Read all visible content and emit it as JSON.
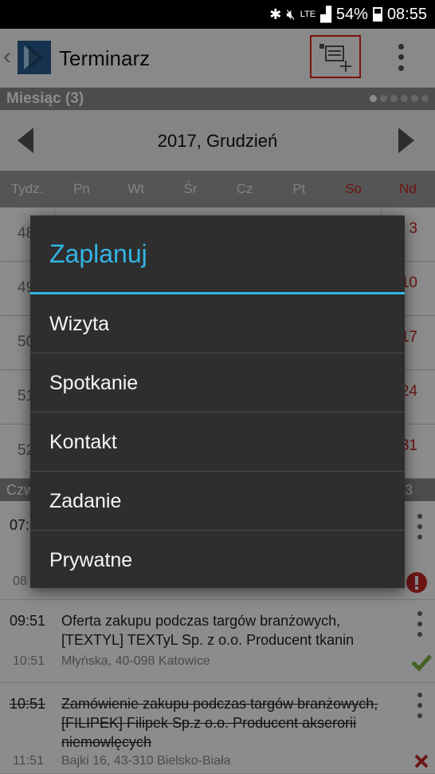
{
  "status": {
    "network": "LTE",
    "battery": "54%",
    "time": "08:55"
  },
  "app": {
    "title": "Terminarz"
  },
  "calendar": {
    "section_label": "Miesiąc (3)",
    "month_title": "2017, Grudzień",
    "weekdays": [
      "Tydz.",
      "Pn",
      "Wt",
      "Śr",
      "Cz",
      "Pt",
      "So",
      "Nd"
    ],
    "rows": [
      {
        "week": "48",
        "sunday": "3"
      },
      {
        "week": "49",
        "sunday": "10"
      },
      {
        "week": "50",
        "sunday": "17"
      },
      {
        "week": "51",
        "sunday": "24"
      },
      {
        "week": "52",
        "sunday": "31"
      }
    ]
  },
  "day": {
    "label": "Czw",
    "count": "3"
  },
  "events": [
    {
      "start": "07:",
      "end": "08",
      "title": "",
      "address": "",
      "status": "error"
    },
    {
      "start": "09:51",
      "end": "10:51",
      "title": "Oferta zakupu podczas targów branżowych, [TEXTYL] TEXTyL Sp. z o.o. Producent tkanin",
      "address": "Młyńska, 40-098 Katowice",
      "status": "done"
    },
    {
      "start": "10:51",
      "end": "11:51",
      "title": "Zamówienie zakupu podczas targów branżowych, [FILIPEK] Filipek Sp.z o.o. Producent akserorii niemowlęcych",
      "address": "Bajki 16, 43-310 Bielsko-Biała",
      "status": "cancelled"
    }
  ],
  "dialog": {
    "title": "Zaplanuj",
    "options": [
      "Wizyta",
      "Spotkanie",
      "Kontakt",
      "Zadanie",
      "Prywatne"
    ]
  },
  "colors": {
    "accent": "#33b5e5",
    "highlight": "#e0221b",
    "weekend": "#c7211b",
    "done": "#7cb342",
    "error": "#c62828"
  }
}
